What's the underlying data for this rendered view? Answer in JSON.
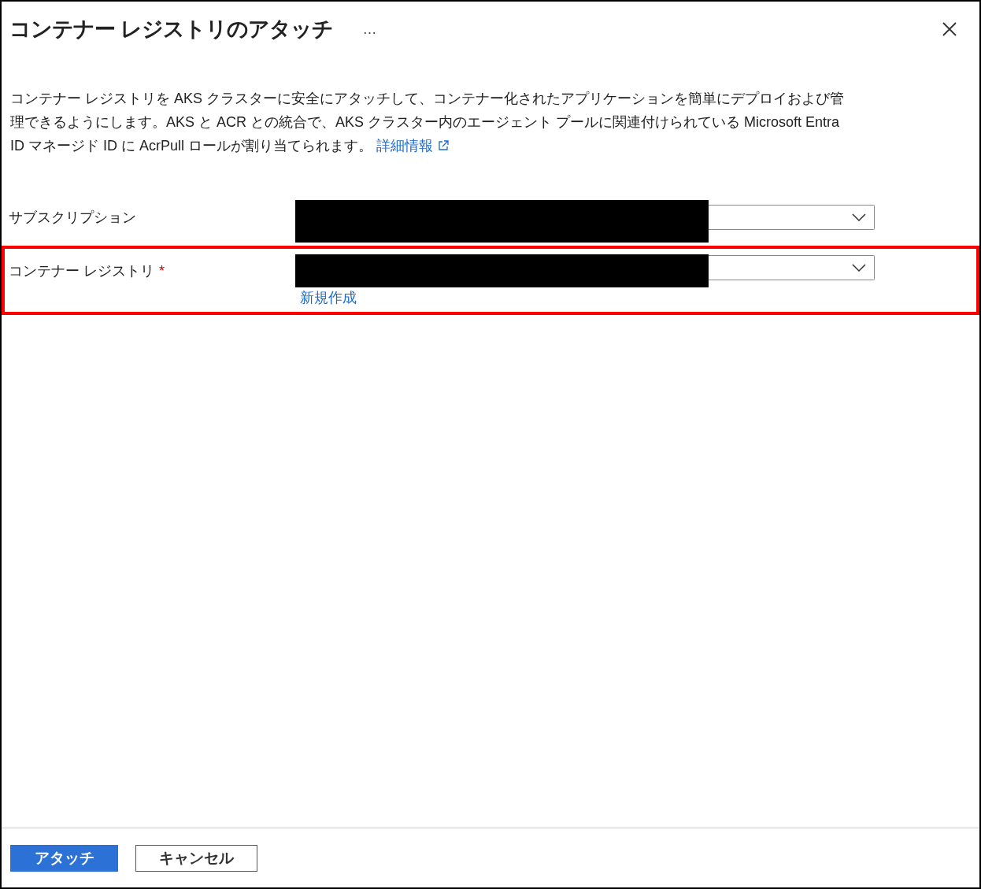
{
  "panel": {
    "title": "コンテナー レジストリのアタッチ",
    "more": "…",
    "description": "コンテナー レジストリを AKS クラスターに安全にアタッチして、コンテナー化されたアプリケーションを簡単にデプロイおよび管理できるようにします。AKS と ACR との統合で、AKS クラスター内のエージェント プールに関連付けられている Microsoft Entra ID マネージド ID に AcrPull ロールが割り当てられます。",
    "learn_more": "詳細情報"
  },
  "fields": [
    {
      "label": "サブスクリプション",
      "redacted": true,
      "highlighted": false
    },
    {
      "label": "コンテナー レジストリ",
      "required_mark": "*",
      "redacted": true,
      "highlighted": true,
      "link": "新規作成"
    }
  ],
  "buttons": [
    {
      "label": "アタッチ",
      "kind": "primary"
    },
    {
      "label": "キャンセル",
      "kind": "secondary"
    }
  ]
}
